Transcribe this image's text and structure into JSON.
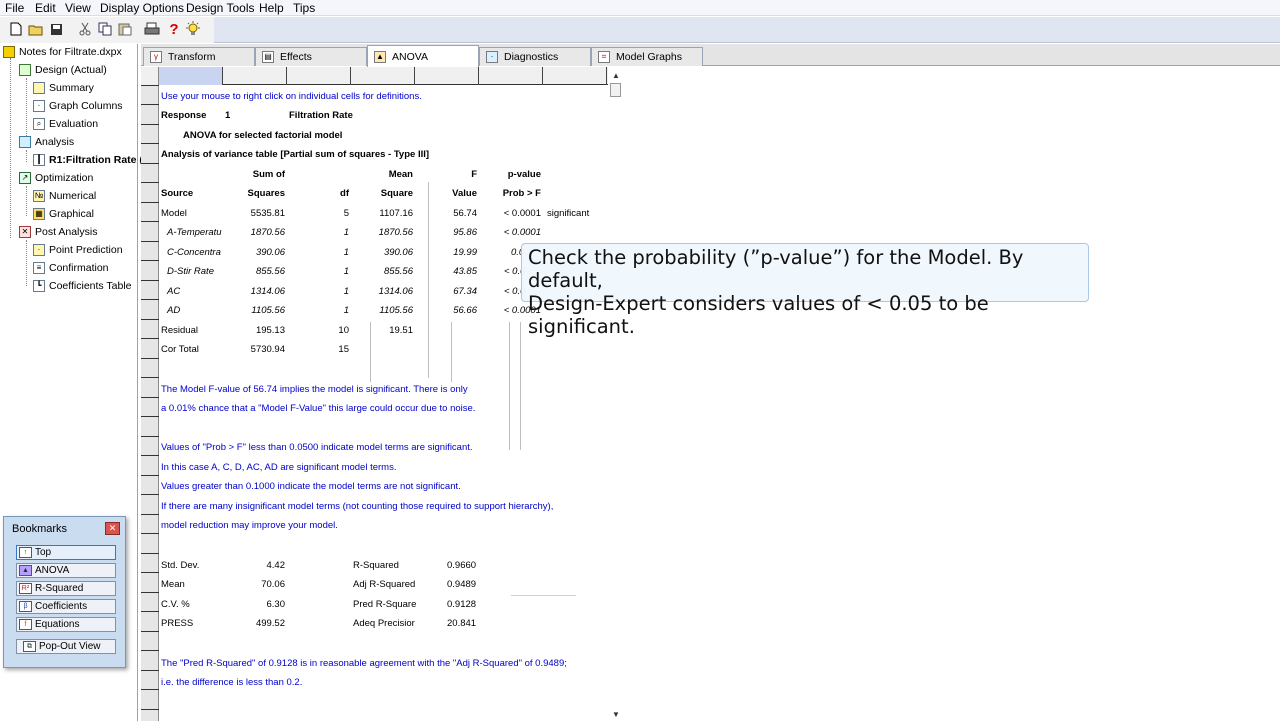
{
  "menu": [
    "File",
    "Edit",
    "View",
    "Display Options",
    "Design Tools",
    "Help",
    "Tips"
  ],
  "toolbar_icons": [
    "new-file-icon",
    "open-folder-icon",
    "save-icon",
    "cut-icon",
    "copy-icon",
    "paste-icon",
    "print-icon",
    "help-icon",
    "tip-bulb-icon"
  ],
  "tree": {
    "root": "Notes for Filtrate.dxpx",
    "design": "Design (Actual)",
    "summary": "Summary",
    "graph_columns": "Graph Columns",
    "evaluation": "Evaluation",
    "analysis": "Analysis",
    "response": "R1:Filtration Rate (",
    "optimization": "Optimization",
    "numerical": "Numerical",
    "graphical": "Graphical",
    "post_analysis": "Post Analysis",
    "point_prediction": "Point Prediction",
    "confirmation": "Confirmation",
    "coefficients_table": "Coefficients Table"
  },
  "bookmarks": {
    "title": "Bookmarks",
    "items": [
      "Top",
      "ANOVA",
      "R-Squared",
      "Coefficients",
      "Equations"
    ],
    "popout": "Pop-Out View"
  },
  "tabs": [
    "Transform",
    "Effects",
    "ANOVA",
    "Diagnostics",
    "Model Graphs"
  ],
  "sheet": {
    "hint": "Use your mouse to right click on individual cells for definitions.",
    "response_label": "Response",
    "response_num": "1",
    "response_name": "Filtration Rate",
    "model_title": "ANOVA for selected factorial model",
    "table_title": "Analysis of variance table [Partial sum of squares - Type III]",
    "headers1": [
      "Sum of",
      "Mean",
      "F",
      "p-value"
    ],
    "headers2": [
      "Source",
      "Squares",
      "df",
      "Square",
      "Value",
      "Prob > F"
    ],
    "rows": [
      {
        "source": "Model",
        "ss": "5535.81",
        "df": "5",
        "ms": "1107.16",
        "f": "56.74",
        "p": "< 0.0001",
        "note": "significant"
      },
      {
        "source": "A-Temperatu",
        "ss": "1870.56",
        "df": "1",
        "ms": "1870.56",
        "f": "95.86",
        "p": "< 0.0001",
        "note": ""
      },
      {
        "source": "C-Concentra",
        "ss": "390.06",
        "df": "1",
        "ms": "390.06",
        "f": "19.99",
        "p": "0.0",
        "note": ""
      },
      {
        "source": "D-Stir Rate",
        "ss": "855.56",
        "df": "1",
        "ms": "855.56",
        "f": "43.85",
        "p": "< 0.0",
        "note": ""
      },
      {
        "source": "AC",
        "ss": "1314.06",
        "df": "1",
        "ms": "1314.06",
        "f": "67.34",
        "p": "< 0.0",
        "note": ""
      },
      {
        "source": "AD",
        "ss": "1105.56",
        "df": "1",
        "ms": "1105.56",
        "f": "56.66",
        "p": "< 0.0001",
        "note": ""
      },
      {
        "source": "Residual",
        "ss": "195.13",
        "df": "10",
        "ms": "19.51",
        "f": "",
        "p": "",
        "note": ""
      },
      {
        "source": "Cor Total",
        "ss": "5730.94",
        "df": "15",
        "ms": "",
        "f": "",
        "p": "",
        "note": ""
      }
    ],
    "notes": [
      "The Model F-value of 56.74 implies the model is significant.  There is only",
      "a 0.01% chance that a \"Model F-Value\" this large could occur due to noise.",
      "Values of \"Prob > F\" less than 0.0500 indicate model terms are significant.",
      "In this case A, C, D, AC, AD are significant model terms.",
      "Values greater than 0.1000 indicate the model terms are not significant.",
      "If there are many insignificant model terms (not counting those required to support hierarchy),",
      "model reduction may improve your model."
    ],
    "stats": [
      {
        "label": "Std. Dev.",
        "value": "4.42",
        "label2": "R-Squared",
        "value2": "0.9660"
      },
      {
        "label": "Mean",
        "value": "70.06",
        "label2": "Adj R-Squared",
        "value2": "0.9489"
      },
      {
        "label": "C.V. %",
        "value": "6.30",
        "label2": "Pred R-Square",
        "value2": "0.9128"
      },
      {
        "label": "PRESS",
        "value": "499.52",
        "label2": "Adeq Precisior",
        "value2": "20.841"
      }
    ],
    "final_notes": [
      "The \"Pred R-Squared\" of 0.9128 is in reasonable agreement with the \"Adj R-Squared\" of 0.9489;",
      "i.e. the difference is less than 0.2."
    ]
  },
  "callout": {
    "line1": "Check the probability (”p-value”) for the Model.  By default,",
    "line2": "Design-Expert considers values of < 0.05 to be significant."
  }
}
